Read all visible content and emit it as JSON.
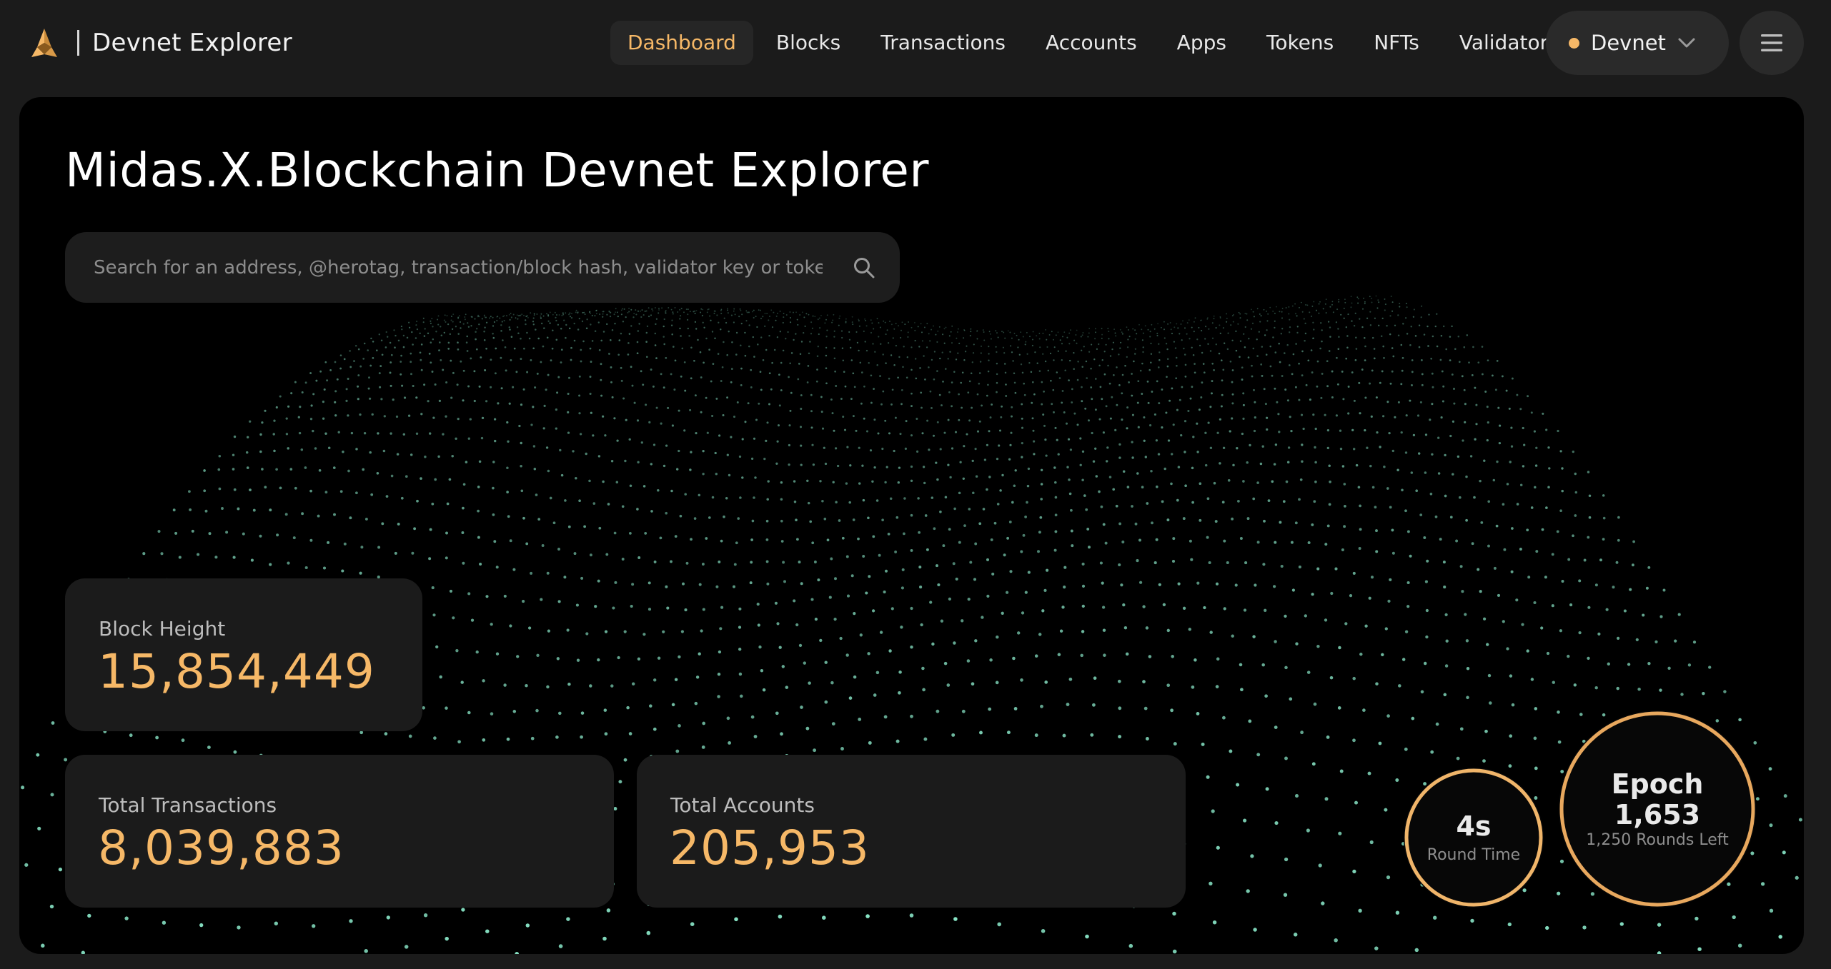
{
  "header": {
    "brand_title": "Devnet Explorer",
    "nav": [
      {
        "label": "Dashboard",
        "active": true
      },
      {
        "label": "Blocks",
        "active": false
      },
      {
        "label": "Transactions",
        "active": false
      },
      {
        "label": "Accounts",
        "active": false
      },
      {
        "label": "Apps",
        "active": false
      },
      {
        "label": "Tokens",
        "active": false
      },
      {
        "label": "NFTs",
        "active": false
      },
      {
        "label": "Validators",
        "active": false
      }
    ],
    "network": {
      "label": "Devnet",
      "status_color": "#f6b867"
    },
    "menu_icon": "hamburger-icon"
  },
  "hero": {
    "title": "Midas.X.Blockchain Devnet Explorer",
    "search": {
      "placeholder": "Search for an address, @herotag, transaction/block hash, validator key or token id",
      "value": "",
      "icon": "search-icon"
    },
    "stats": {
      "block_height": {
        "label": "Block Height",
        "value": "15,854,449"
      },
      "total_transactions": {
        "label": "Total Transactions",
        "value": "8,039,883"
      },
      "total_accounts": {
        "label": "Total Accounts",
        "value": "205,953"
      }
    },
    "round": {
      "value": "4s",
      "label": "Round Time"
    },
    "epoch": {
      "label": "Epoch",
      "value": "1,653",
      "rounds_left": "1,250 Rounds Left"
    }
  },
  "colors": {
    "accent": "#f6b867",
    "background": "#1b1b1b",
    "panel": "#000000",
    "card": "#1b1b1b",
    "particles": "#8ff0d0"
  }
}
